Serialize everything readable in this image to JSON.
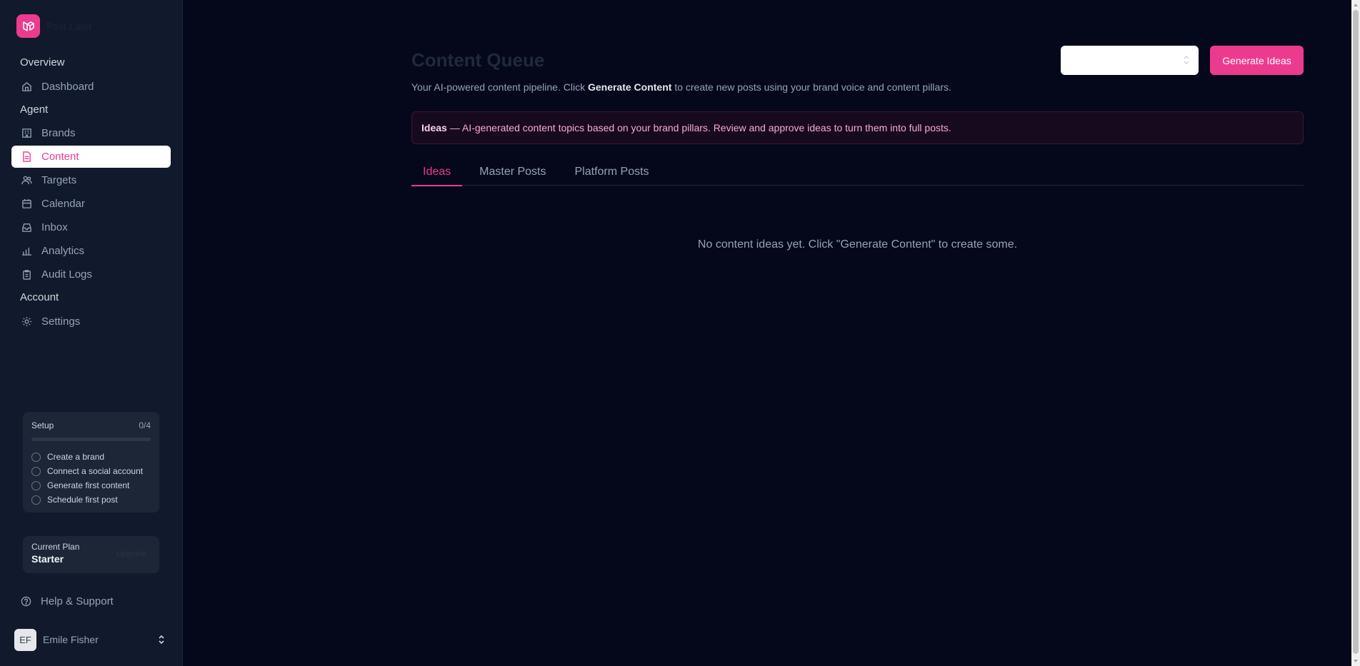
{
  "app": {
    "name": "Post Later",
    "accent": "#ec3b8e"
  },
  "sidebar": {
    "sections": {
      "overview": "Overview",
      "agent": "Agent",
      "account": "Account"
    },
    "items": {
      "dashboard": {
        "label": "Dashboard",
        "icon": "home-icon"
      },
      "brands": {
        "label": "Brands",
        "icon": "building-icon"
      },
      "content": {
        "label": "Content",
        "icon": "document-icon",
        "active": true
      },
      "targets": {
        "label": "Targets",
        "icon": "users-icon"
      },
      "calendar": {
        "label": "Calendar",
        "icon": "calendar-icon"
      },
      "inbox": {
        "label": "Inbox",
        "icon": "inbox-icon"
      },
      "analytics": {
        "label": "Analytics",
        "icon": "bar-chart-icon"
      },
      "audit_logs": {
        "label": "Audit Logs",
        "icon": "clipboard-icon"
      },
      "settings": {
        "label": "Settings",
        "icon": "gear-icon"
      }
    },
    "setup": {
      "title": "Setup",
      "count": "0/4",
      "progress_fraction": 0,
      "items": [
        "Create a brand",
        "Connect a social account",
        "Generate first content",
        "Schedule first post"
      ]
    },
    "plan": {
      "label": "Current Plan",
      "name": "Starter",
      "action": "Upgrade"
    },
    "help": "Help & Support",
    "user": {
      "initials": "EF",
      "name": "Emile Fisher"
    }
  },
  "main": {
    "title": "Content Queue",
    "subtitle_prefix": "Your AI-powered content pipeline. Click ",
    "subtitle_bold": "Generate Content",
    "subtitle_suffix": " to create new posts using your brand voice and content pillars.",
    "brand_select": {
      "value": ""
    },
    "generate_button": "Generate Ideas",
    "info": {
      "bold": "Ideas",
      "text": "— AI-generated content topics based on your brand pillars. Review and approve ideas to turn them into full posts."
    },
    "tabs": [
      "Ideas",
      "Master Posts",
      "Platform Posts"
    ],
    "active_tab": "Ideas",
    "empty_message": "No content ideas yet. Click \"Generate Content\" to create some."
  }
}
